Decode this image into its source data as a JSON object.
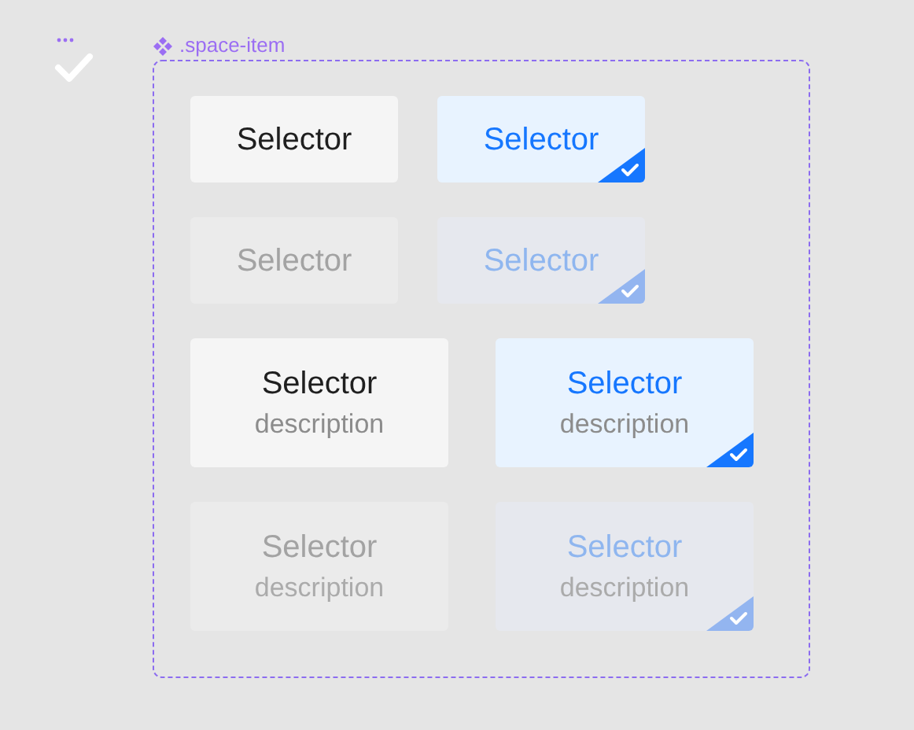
{
  "component": {
    "label": ".space-item"
  },
  "rows": [
    {
      "items": [
        {
          "kind": "simple",
          "title": "Selector",
          "selected": false,
          "disabled": false
        },
        {
          "kind": "simple",
          "title": "Selector",
          "selected": true,
          "disabled": false
        }
      ]
    },
    {
      "items": [
        {
          "kind": "simple",
          "title": "Selector",
          "selected": false,
          "disabled": true
        },
        {
          "kind": "simple",
          "title": "Selector",
          "selected": true,
          "disabled": true
        }
      ]
    },
    {
      "items": [
        {
          "kind": "described",
          "title": "Selector",
          "description": "description",
          "selected": false,
          "disabled": false
        },
        {
          "kind": "described",
          "title": "Selector",
          "description": "description",
          "selected": true,
          "disabled": false
        }
      ]
    },
    {
      "items": [
        {
          "kind": "described",
          "title": "Selector",
          "description": "description",
          "selected": false,
          "disabled": true
        },
        {
          "kind": "described",
          "title": "Selector",
          "description": "description",
          "selected": true,
          "disabled": true
        }
      ]
    }
  ]
}
